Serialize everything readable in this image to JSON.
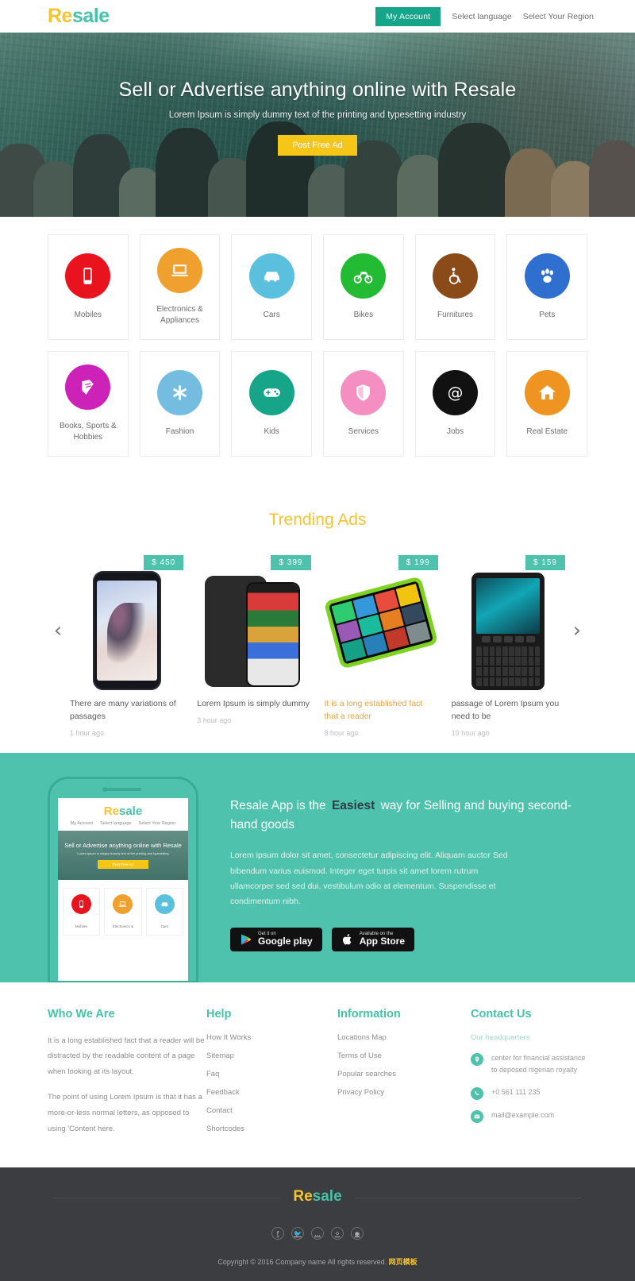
{
  "header": {
    "logo_re": "Re",
    "logo_sale": "sale",
    "account_button": "My Account",
    "links": [
      {
        "label": "Select language"
      },
      {
        "label": "Select Your Region"
      }
    ]
  },
  "hero": {
    "title": "Sell or Advertise anything online with Resale",
    "subtitle": "Lorem Ipsum is simply dummy text of the printing and typesetting industry",
    "cta": "Post Free Ad"
  },
  "categories": [
    {
      "label": "Mobiles",
      "icon": "mobile-icon",
      "color": "#e8131d"
    },
    {
      "label": "Electronics & Appliances",
      "icon": "laptop-icon",
      "color": "#f0a02e"
    },
    {
      "label": "Cars",
      "icon": "car-icon",
      "color": "#5bc0de"
    },
    {
      "label": "Bikes",
      "icon": "motorcycle-icon",
      "color": "#22bb33"
    },
    {
      "label": "Furnitures",
      "icon": "wheelchair-icon",
      "color": "#8a4b18"
    },
    {
      "label": "Pets",
      "icon": "paw-icon",
      "color": "#2f6fd0"
    },
    {
      "label": "Books, Sports & Hobbies",
      "icon": "book-icon",
      "color": "#cc22b8"
    },
    {
      "label": "Fashion",
      "icon": "asterisk-icon",
      "color": "#74bde0"
    },
    {
      "label": "Kids",
      "icon": "gamepad-icon",
      "color": "#17a589"
    },
    {
      "label": "Services",
      "icon": "shield-icon",
      "color": "#f58fc2"
    },
    {
      "label": "Jobs",
      "icon": "at-icon",
      "color": "#111111"
    },
    {
      "label": "Real Estate",
      "icon": "home-icon",
      "color": "#ef9421"
    }
  ],
  "trending": {
    "heading": "Trending Ads",
    "prev_icon": "chevron-left-icon",
    "next_icon": "chevron-right-icon",
    "cards": [
      {
        "price": "$ 450",
        "title": "There are many variations of passages",
        "time": "1 hour ago",
        "highlight": false
      },
      {
        "price": "$ 399",
        "title": "Lorem Ipsum is simply dummy",
        "time": "3 hour ago",
        "highlight": false
      },
      {
        "price": "$ 199",
        "title": "It is a long established fact that a reader",
        "time": "8 hour ago",
        "highlight": true
      },
      {
        "price": "$ 159",
        "title": "passage of Lorem Ipsum you need to be",
        "time": "19 hour ago",
        "highlight": false
      }
    ]
  },
  "app": {
    "title_before": "Resale App is the",
    "title_highlight": "Easiest",
    "title_after": "way for Selling and buying second-hand goods",
    "body": "Lorem ipsum dolor sit amet, consectetur adipiscing elit. Aliquam auctor Sed bibendum varius euismod. Integer eget turpis sit amet lorem rutrum ullamcorper sed sed dui, vestibulum odio at elementum. Suspendisse et condimentum nibh.",
    "google_play": {
      "small": "Get it on",
      "large": "Google play",
      "icon": "google-play-icon"
    },
    "app_store": {
      "small": "Available on the",
      "large": "App Store",
      "icon": "apple-icon"
    },
    "mock": {
      "logo_re": "Re",
      "logo_sale": "sale",
      "nav": [
        "My Account",
        "Select language",
        "Select Your Region"
      ],
      "hero_title": "Sell or Advertise anything online with Resale",
      "hero_sub": "Lorem Ipsum is simply dummy text of the printing and typesetting",
      "hero_cta": "Post Free Ad",
      "cats": [
        {
          "label": "Mobiles",
          "color": "#e8131d",
          "icon": "mobile-icon"
        },
        {
          "label": "Electronics &",
          "color": "#f0a02e",
          "icon": "laptop-icon"
        },
        {
          "label": "Cars",
          "color": "#5bc0de",
          "icon": "car-icon"
        }
      ]
    }
  },
  "footer": {
    "who": {
      "title": "Who We Are",
      "p1": "It is a long established fact that a reader will be distracted by the readable content of a page when looking at its layout.",
      "p2": "The point of using Lorem Ipsum is that it has a more-or-less normal letters, as opposed to using 'Content here."
    },
    "help": {
      "title": "Help",
      "links": [
        "How It Works",
        "Sitemap",
        "Faq",
        "Feedback",
        "Contact",
        "Shortcodes"
      ]
    },
    "information": {
      "title": "Information",
      "links": [
        "Locations Map",
        "Terms of Use",
        "Popular searches",
        "Privacy Policy"
      ]
    },
    "contact": {
      "title": "Contact Us",
      "hq": "Our headquarters",
      "address": "center for financial assistance to deposed nigerian royalty",
      "phone": "+0 561 111 235",
      "email": "mail@example.com",
      "icons": {
        "address": "map-pin-icon",
        "phone": "phone-icon",
        "email": "envelope-icon"
      }
    }
  },
  "bottom": {
    "logo_re": "Re",
    "logo_sale": "sale",
    "socials": [
      "facebook-icon",
      "twitter-icon",
      "flickr-icon",
      "dribbble-icon",
      "behance-icon"
    ],
    "copyright": "Copyright © 2016 Company name All rights reserved.",
    "credit": "网页模板"
  }
}
